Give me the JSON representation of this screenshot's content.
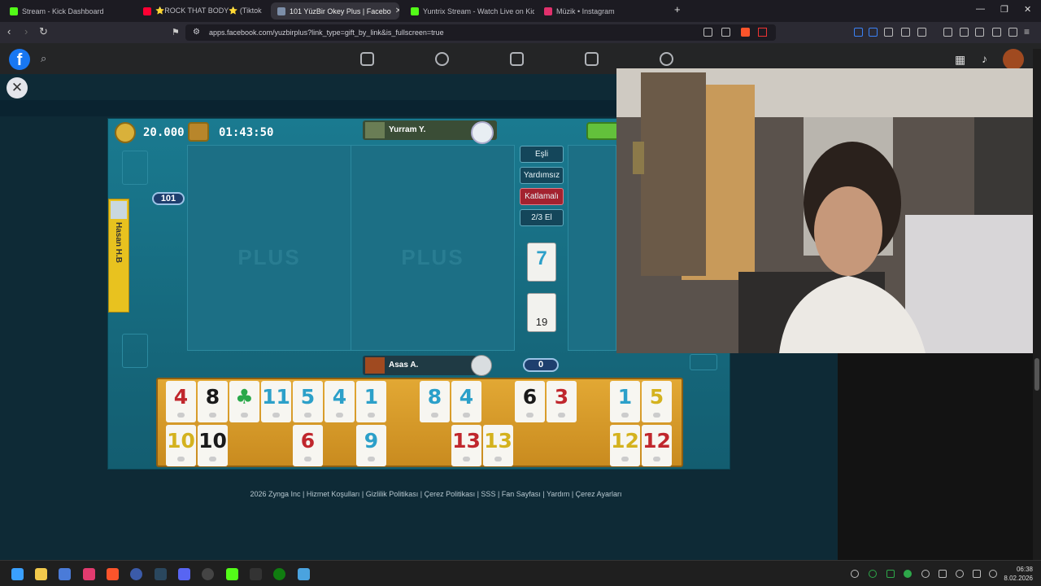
{
  "browser": {
    "tabs": [
      {
        "label": "Stream - Kick Dashboard",
        "color": "#53fc18"
      },
      {
        "label": "⭐ROCK THAT BODY⭐ (Tiktok",
        "color": "#ff0033"
      },
      {
        "label": "101 YüzBir Okey Plus | Facebo",
        "color": "#7c8ea8"
      },
      {
        "label": "Yuntrix Stream - Watch Live on Kick",
        "color": "#53fc18"
      },
      {
        "label": "Müzik • Instagram",
        "color": "#e1306c"
      }
    ],
    "new_tab": "+",
    "url": "apps.facebook.com/yuzbirplus?link_type=gift_by_link&is_fullscreen=true"
  },
  "facebook": {
    "logo": "f",
    "close": "✕"
  },
  "game": {
    "coins": "20.000",
    "timer": "01:43:50",
    "top_player": "Yurram Y.",
    "left_player": "Hasan H.B",
    "bottom_player": "Asas A.",
    "left_score": "101",
    "bottom_score": "0",
    "board_watermark": "PLUS",
    "options": [
      "Eşli",
      "Yardımsız",
      "Katlamalı",
      "2/3 El"
    ],
    "indicator_tile": "7",
    "pile_count": "19",
    "rack_row1": [
      {
        "v": "4",
        "c": "red"
      },
      {
        "v": "8",
        "c": "black"
      },
      {
        "v": "♣",
        "c": "green"
      },
      {
        "v": "11",
        "c": "blue"
      },
      {
        "v": "5",
        "c": "blue"
      },
      {
        "v": "4",
        "c": "blue"
      },
      {
        "v": "1",
        "c": "blue"
      },
      {
        "v": "",
        "c": "empty"
      },
      {
        "v": "8",
        "c": "blue"
      },
      {
        "v": "4",
        "c": "blue"
      },
      {
        "v": "",
        "c": "empty"
      },
      {
        "v": "6",
        "c": "black"
      },
      {
        "v": "3",
        "c": "red"
      },
      {
        "v": "",
        "c": "empty"
      },
      {
        "v": "1",
        "c": "blue"
      },
      {
        "v": "5",
        "c": "yellow"
      }
    ],
    "rack_row2": [
      {
        "v": "10",
        "c": "yellow"
      },
      {
        "v": "10",
        "c": "black"
      },
      {
        "v": "",
        "c": "empty"
      },
      {
        "v": "",
        "c": "empty"
      },
      {
        "v": "6",
        "c": "red"
      },
      {
        "v": "",
        "c": "empty"
      },
      {
        "v": "9",
        "c": "blue"
      },
      {
        "v": "",
        "c": "empty"
      },
      {
        "v": "",
        "c": "empty"
      },
      {
        "v": "13",
        "c": "red"
      },
      {
        "v": "13",
        "c": "yellow"
      },
      {
        "v": "",
        "c": "empty"
      },
      {
        "v": "",
        "c": "empty"
      },
      {
        "v": "",
        "c": "empty"
      },
      {
        "v": "12",
        "c": "yellow"
      },
      {
        "v": "12",
        "c": "red"
      }
    ]
  },
  "footer": "2026 Zynga Inc | Hizmet Koşulları | Gizlilik Politikası | Çerez Politikası | SSS | Fan Sayfası | Yardım | Çerez Ayarları",
  "taskbar": {
    "time": "06:38",
    "date": "8.02.2026"
  }
}
